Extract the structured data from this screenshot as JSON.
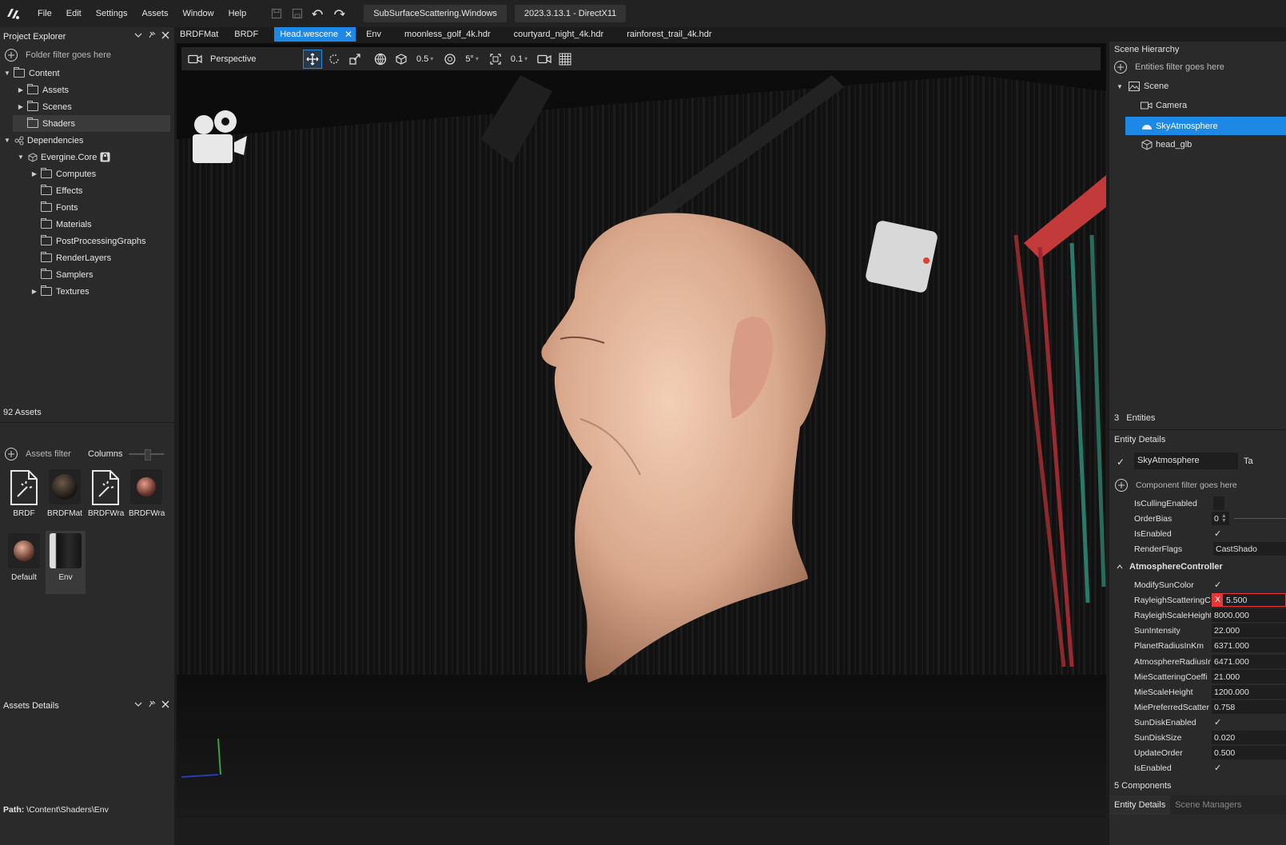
{
  "menubar": {
    "items": [
      "File",
      "Edit",
      "Settings",
      "Assets",
      "Window",
      "Help"
    ],
    "project_pill": "SubSurfaceScattering.Windows",
    "version_pill": "2023.3.13.1 - DirectX11"
  },
  "tabs": [
    {
      "label": "BRDFMat",
      "active": false
    },
    {
      "label": "BRDF",
      "active": false
    },
    {
      "label": "Head.wescene",
      "active": true
    },
    {
      "label": "Env",
      "active": false
    },
    {
      "label": "moonless_golf_4k.hdr",
      "active": false
    },
    {
      "label": "courtyard_night_4k.hdr",
      "active": false
    },
    {
      "label": "rainforest_trail_4k.hdr",
      "active": false
    }
  ],
  "project_explorer": {
    "title": "Project Explorer",
    "filter_placeholder": "Folder filter goes here",
    "tree": [
      {
        "label": "Content",
        "expanded": true
      },
      {
        "label": "Assets"
      },
      {
        "label": "Scenes"
      },
      {
        "label": "Shaders",
        "selected": true
      },
      {
        "label": "Dependencies",
        "expanded": true
      },
      {
        "label": "Evergine.Core",
        "expanded": true
      },
      {
        "label": "Computes"
      },
      {
        "label": "Effects"
      },
      {
        "label": "Fonts"
      },
      {
        "label": "Materials"
      },
      {
        "label": "PostProcessingGraphs"
      },
      {
        "label": "RenderLayers"
      },
      {
        "label": "Samplers"
      },
      {
        "label": "Textures"
      }
    ],
    "asset_count": "92 Assets"
  },
  "assets_details": {
    "title": "Assets Details",
    "filter_placeholder": "Assets filter",
    "columns_label": "Columns",
    "tiles": [
      {
        "label": "BRDF",
        "kind": "effect"
      },
      {
        "label": "BRDFMat",
        "kind": "material-dark"
      },
      {
        "label": "BRDFWra",
        "kind": "effect"
      },
      {
        "label": "BRDFWra",
        "kind": "material-pink"
      },
      {
        "label": "Default",
        "kind": "material-skin"
      },
      {
        "label": "Env",
        "kind": "env"
      }
    ],
    "path_label": "Path:",
    "path_value": "\\Content\\Shaders\\Env"
  },
  "viewport": {
    "camera_mode": "Perspective",
    "move_snap": "0.5",
    "rotate_snap": "5°",
    "scale_snap": "0.1"
  },
  "scene_hierarchy": {
    "title": "Scene Hierarchy",
    "filter_placeholder": "Entities filter goes here",
    "root": "Scene",
    "entities": [
      {
        "label": "Camera",
        "selected": false,
        "icon": "camera-icon"
      },
      {
        "label": "SkyAtmosphere",
        "selected": true,
        "icon": "sky-icon"
      },
      {
        "label": "head_glb",
        "selected": false,
        "icon": "cube-icon"
      }
    ],
    "entity_count_num": "3",
    "entity_count_label": "Entities"
  },
  "entity_details": {
    "title": "Entity Details",
    "name": "SkyAtmosphere",
    "tag_label": "Ta",
    "component_filter_placeholder": "Component filter goes here",
    "base_props": [
      {
        "name": "IsCullingEnabled",
        "type": "check",
        "value": ""
      },
      {
        "name": "OrderBias",
        "type": "num",
        "value": "0"
      },
      {
        "name": "IsEnabled",
        "type": "check",
        "value": "✓"
      },
      {
        "name": "RenderFlags",
        "type": "text",
        "value": "CastShado"
      }
    ],
    "component_title": "AtmosphereController",
    "component_props": [
      {
        "name": "ModifySunColor",
        "type": "check",
        "value": "✓"
      },
      {
        "name": "RayleighScatteringC",
        "type": "vec",
        "value": "5.500",
        "axis": "X"
      },
      {
        "name": "RayleighScaleHeight",
        "type": "num",
        "value": "8000.000"
      },
      {
        "name": "SunIntensity",
        "type": "num",
        "value": "22.000"
      },
      {
        "name": "PlanetRadiusInKm",
        "type": "num",
        "value": "6371.000"
      },
      {
        "name": "AtmosphereRadiusIn",
        "type": "num",
        "value": "6471.000"
      },
      {
        "name": "MieScatteringCoeffi",
        "type": "num",
        "value": "21.000"
      },
      {
        "name": "MieScaleHeight",
        "type": "num",
        "value": "1200.000"
      },
      {
        "name": "MiePreferredScatter",
        "type": "num",
        "value": "0.758"
      },
      {
        "name": "SunDiskEnabled",
        "type": "check",
        "value": "✓"
      },
      {
        "name": "SunDiskSize",
        "type": "num",
        "value": "0.020"
      },
      {
        "name": "UpdateOrder",
        "type": "num",
        "value": "0.500"
      },
      {
        "name": "IsEnabled",
        "type": "check",
        "value": "✓"
      }
    ],
    "components_count": "5 Components",
    "bottom_tabs": [
      "Entity Details",
      "Scene Managers"
    ]
  },
  "colors": {
    "accent": "#1e88e5",
    "panel": "#2a2a2a",
    "background": "#1c1c1c",
    "axis_x": "#e53935"
  }
}
